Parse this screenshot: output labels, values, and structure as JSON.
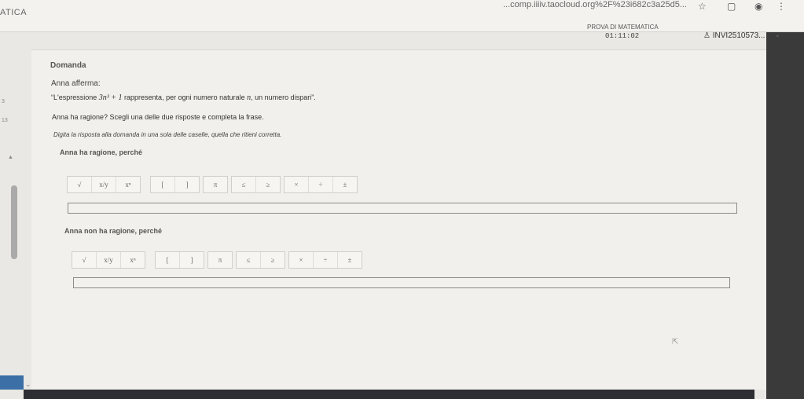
{
  "browser": {
    "app_title": "ATICA",
    "url": "...comp.iiiiv.taocloud.org%2F%23i682c3a25d5...",
    "icons": [
      "star-icon",
      "extension-icon",
      "profile-icon",
      "menu-icon"
    ]
  },
  "exam": {
    "title": "PROVA DI MATEMATICA",
    "timer": "01:11:02",
    "user": "INVI2510573..."
  },
  "sidebar": {
    "numbers": [
      "3",
      "13"
    ]
  },
  "question": {
    "heading": "Domanda",
    "intro": "Anna afferma:",
    "statement_prefix": "“L'espressione",
    "statement_math": "3n³ + 1",
    "statement_mid": "rappresenta, per ogni numero naturale",
    "statement_var": "n",
    "statement_suffix": ", un numero dispari”.",
    "question": "Anna ha ragione? Scegli una delle due risposte e completa la frase.",
    "instruction": "Digita la risposta alla domanda in una sola delle caselle, quella che ritieni corretta."
  },
  "options": [
    {
      "label": "Anna ha ragione, perché",
      "value": ""
    },
    {
      "label": "Anna non ha ragione, perché",
      "value": ""
    }
  ],
  "toolbar_groups": [
    [
      "√",
      "x/y",
      "xⁿ"
    ],
    [
      "[",
      "]"
    ],
    [
      "π"
    ],
    [
      "≤",
      "≥"
    ],
    [
      "×",
      "÷",
      "±"
    ]
  ]
}
